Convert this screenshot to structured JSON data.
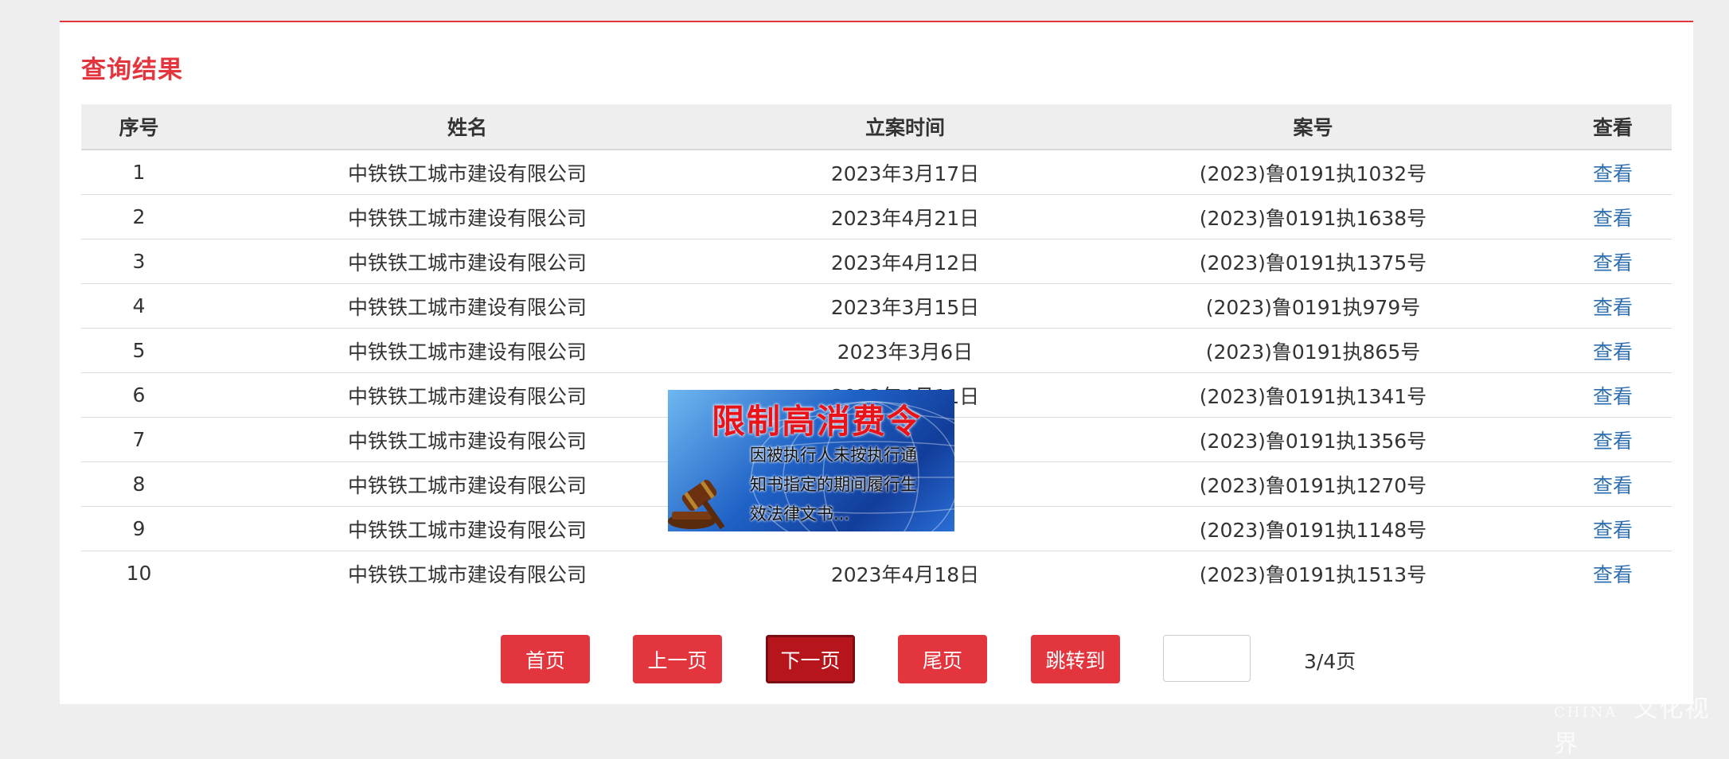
{
  "title": "查询结果",
  "table": {
    "headers": [
      "序号",
      "姓名",
      "立案时间",
      "案号",
      "查看"
    ],
    "rows": [
      {
        "no": "1",
        "name": "中铁铁工城市建设有限公司",
        "date": "2023年3月17日",
        "case": "(2023)鲁0191执1032号",
        "view": "查看"
      },
      {
        "no": "2",
        "name": "中铁铁工城市建设有限公司",
        "date": "2023年4月21日",
        "case": "(2023)鲁0191执1638号",
        "view": "查看"
      },
      {
        "no": "3",
        "name": "中铁铁工城市建设有限公司",
        "date": "2023年4月12日",
        "case": "(2023)鲁0191执1375号",
        "view": "查看"
      },
      {
        "no": "4",
        "name": "中铁铁工城市建设有限公司",
        "date": "2023年3月15日",
        "case": "(2023)鲁0191执979号",
        "view": "查看"
      },
      {
        "no": "5",
        "name": "中铁铁工城市建设有限公司",
        "date": "2023年3月6日",
        "case": "(2023)鲁0191执865号",
        "view": "查看"
      },
      {
        "no": "6",
        "name": "中铁铁工城市建设有限公司",
        "date": "2023年4月11日",
        "case": "(2023)鲁0191执1341号",
        "view": "查看"
      },
      {
        "no": "7",
        "name": "中铁铁工城市建设有限公司",
        "date": "",
        "case": "(2023)鲁0191执1356号",
        "view": "查看"
      },
      {
        "no": "8",
        "name": "中铁铁工城市建设有限公司",
        "date": "",
        "case": "(2023)鲁0191执1270号",
        "view": "查看"
      },
      {
        "no": "9",
        "name": "中铁铁工城市建设有限公司",
        "date": "",
        "case": "(2023)鲁0191执1148号",
        "view": "查看"
      },
      {
        "no": "10",
        "name": "中铁铁工城市建设有限公司",
        "date": "2023年4月18日",
        "case": "(2023)鲁0191执1513号",
        "view": "查看"
      }
    ]
  },
  "pagination": {
    "first": "首页",
    "prev": "上一页",
    "next": "下一页",
    "last": "尾页",
    "jump": "跳转到",
    "jump_value": "",
    "page_info": "3/4页",
    "current_page": 3,
    "total_pages": 4
  },
  "ad": {
    "title": "限制高消费令",
    "lines": [
      "因被执行人未按执行通",
      "知书指定的期间履行生",
      "效法律文书..."
    ]
  },
  "watermark": {
    "text": "文化视界",
    "latin": "CHINA"
  },
  "colors": {
    "accent": "#e2353d",
    "accent_active": "#b7151c",
    "link": "#2f6fb0",
    "header_bg": "#eeeeee"
  }
}
